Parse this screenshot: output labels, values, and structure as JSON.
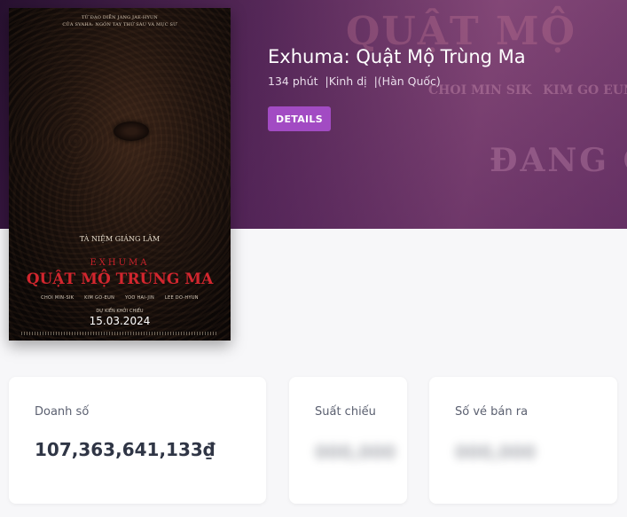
{
  "movie": {
    "title": "Exhuma: Quật Mộ Trùng Ma",
    "duration": "134 phút",
    "genre": "|Kinh dị",
    "country": "|(Hàn Quốc)",
    "details_label": "DETAILS"
  },
  "banner_background": {
    "title": "QUẬT MỘ",
    "cast_1": "CHOI MIN SIK",
    "cast_2": "KIM GO EUN",
    "status": "ĐANG CHI"
  },
  "poster": {
    "credit_1": "TỪ ĐẠO DIỄN JANG JAE-HYUN",
    "credit_2": "CỦA SVAHA: NGÓN TAY THỨ SÁU VÀ MỤC SƯ",
    "tagline": "TÀ NIỆM GIÁNG LÂM",
    "title_en": "EXHUMA",
    "title_vn": "QUẬT MỘ TRÙNG MA",
    "cast": [
      "CHOI MIN-SIK",
      "KIM GO-EUN",
      "YOO HAI-JIN",
      "LEE DO-HYUN"
    ],
    "release_label": "DỰ KIẾN KHỞI CHIẾU",
    "release_date": "15.03.2024"
  },
  "stats": {
    "revenue": {
      "label": "Doanh số",
      "value": "107,363,641,133₫"
    },
    "showtimes": {
      "label": "Suất chiếu",
      "value": "000,000"
    },
    "tickets": {
      "label": "Số vé bán ra",
      "value": "000,000"
    }
  },
  "colors": {
    "accent": "#a24bc3",
    "banner": "#5a2a5d",
    "poster_title": "#d2262e"
  }
}
